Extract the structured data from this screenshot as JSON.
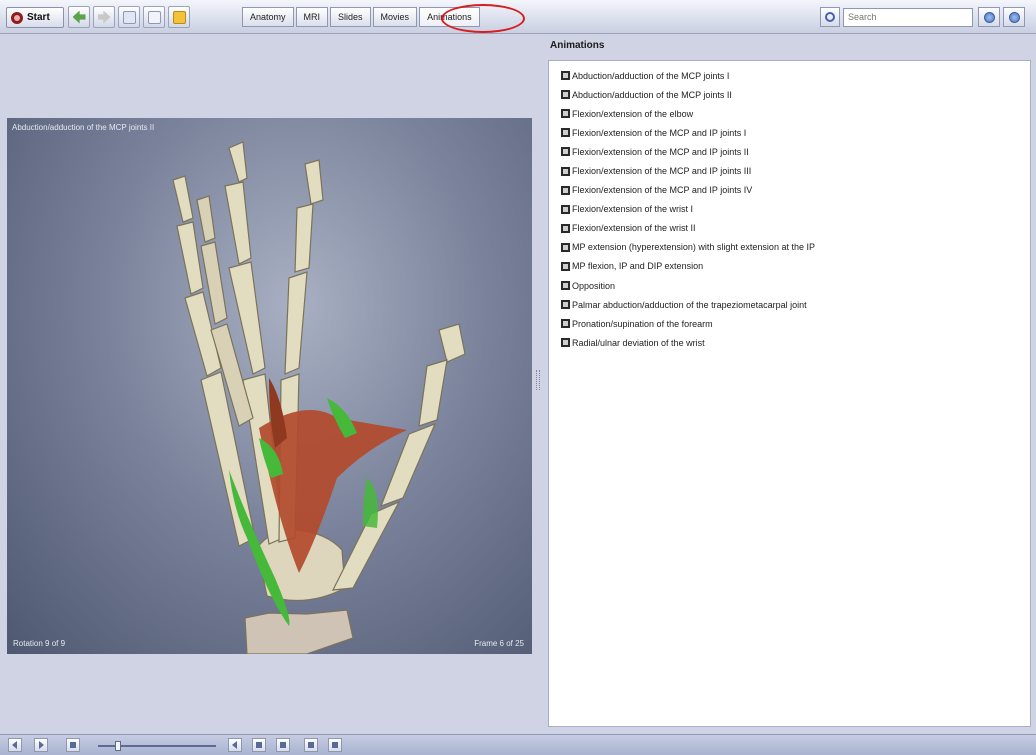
{
  "toolbar": {
    "start_label": "Start",
    "tabs": [
      {
        "label": "Anatomy"
      },
      {
        "label": "MRI"
      },
      {
        "label": "Slides"
      },
      {
        "label": "Movies"
      },
      {
        "label": "Animations"
      }
    ],
    "active_tab": "Animations",
    "search_placeholder": "Search"
  },
  "viewer": {
    "title": "Abduction/adduction of the MCP joints II",
    "rotation": "Rotation 9 of 9",
    "frame": "Frame 6 of 25"
  },
  "panel": {
    "title": "Animations",
    "items": [
      {
        "label": "Abduction/adduction of the MCP joints I"
      },
      {
        "label": "Abduction/adduction of the MCP joints II"
      },
      {
        "label": "Flexion/extension of the elbow"
      },
      {
        "label": "Flexion/extension of the MCP and IP joints I"
      },
      {
        "label": "Flexion/extension of the MCP and IP joints II"
      },
      {
        "label": "Flexion/extension of the MCP and IP joints III"
      },
      {
        "label": "Flexion/extension of the MCP and IP joints IV"
      },
      {
        "label": "Flexion/extension of the wrist I"
      },
      {
        "label": "Flexion/extension of the wrist II"
      },
      {
        "label": "MP extension (hyperextension) with slight extension at the IP"
      },
      {
        "label": "MP flexion, IP and DIP extension"
      },
      {
        "label": "Opposition"
      },
      {
        "label": "Palmar abduction/adduction of the trapeziometacarpal joint"
      },
      {
        "label": "Pronation/supination of the forearm"
      },
      {
        "label": "Radial/ulnar deviation of the wrist"
      }
    ]
  },
  "colors": {
    "bone": "#e2dcc0",
    "muscle_red": "#b24a2d",
    "muscle_green": "#46b83a",
    "annotation_circle": "#d61e1e"
  }
}
